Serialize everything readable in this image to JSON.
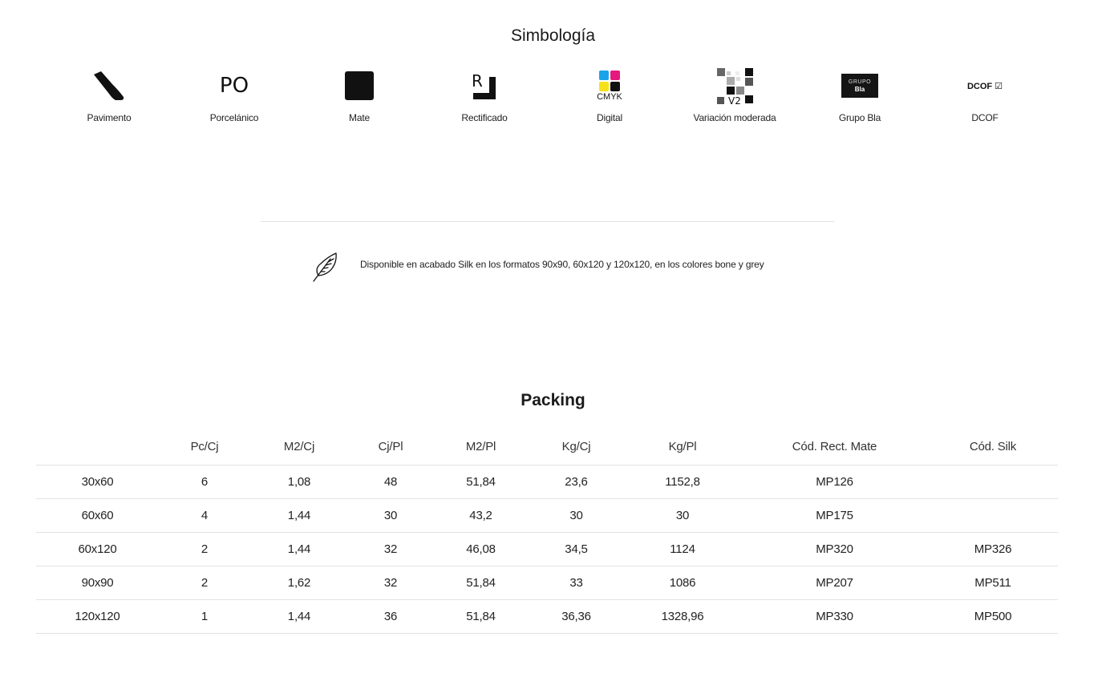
{
  "symbology": {
    "title": "Simbología",
    "items": [
      {
        "icon": "floor-tile-foot-icon",
        "label": "Pavimento"
      },
      {
        "icon": "porcelain-po-icon",
        "label": "Porcelánico",
        "icon_text": "PO"
      },
      {
        "icon": "matte-square-icon",
        "label": "Mate"
      },
      {
        "icon": "rectified-r-icon",
        "label": "Rectificado",
        "icon_text": "R"
      },
      {
        "icon": "cmyk-digital-icon",
        "label": "Digital",
        "icon_text": "CMYK"
      },
      {
        "icon": "shade-variation-v2-icon",
        "label": "Variación moderada",
        "icon_text": "V2"
      },
      {
        "icon": "grupo-bla-icon",
        "label": "Grupo Bla",
        "icon_text_top": "GRUPO",
        "icon_text_bottom": "Bla"
      },
      {
        "icon": "dcof-icon",
        "label": "DCOF",
        "icon_text": "DCOF ☑"
      }
    ],
    "colors": {
      "cyan": "#1aa3e8",
      "magenta": "#e5197e",
      "yellow": "#f7e11a",
      "black": "#111111"
    }
  },
  "note": {
    "icon": "feather-icon",
    "text": "Disponible en acabado Silk en los formatos 90x90, 60x120 y 120x120, en los colores bone y grey"
  },
  "packing": {
    "title": "Packing",
    "headers": [
      "",
      "Pc/Cj",
      "M2/Cj",
      "Cj/Pl",
      "M2/Pl",
      "Kg/Cj",
      "Kg/Pl",
      "Cód. Rect. Mate",
      "Cód. Silk"
    ],
    "rows": [
      [
        "30x60",
        "6",
        "1,08",
        "48",
        "51,84",
        "23,6",
        "1152,8",
        "MP126",
        ""
      ],
      [
        "60x60",
        "4",
        "1,44",
        "30",
        "43,2",
        "30",
        "30",
        "MP175",
        ""
      ],
      [
        "60x120",
        "2",
        "1,44",
        "32",
        "46,08",
        "34,5",
        "1124",
        "MP320",
        "MP326"
      ],
      [
        "90x90",
        "2",
        "1,62",
        "32",
        "51,84",
        "33",
        "1086",
        "MP207",
        "MP511"
      ],
      [
        "120x120",
        "1",
        "1,44",
        "36",
        "51,84",
        "36,36",
        "1328,96",
        "MP330",
        "MP500"
      ]
    ]
  }
}
